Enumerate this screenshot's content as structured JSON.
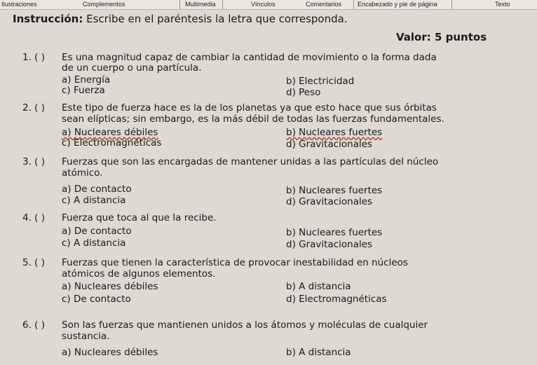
{
  "ribbon": {
    "tabs": [
      "Ilustraciones",
      "Complementos",
      "Multimedia",
      "Vínculos",
      "Comentarios",
      "Encabezado y pie de página",
      "Texto"
    ]
  },
  "worksheet": {
    "instruction_label": "Instrucción:",
    "instruction_text": " Escribe en el paréntesis la letra que corresponda.",
    "valor": "Valor: 5 puntos",
    "questions": [
      {
        "num": "1. (   )",
        "lines": [
          "Es una magnitud capaz de cambiar la cantidad de movimiento o la forma dada",
          "de un cuerpo o una partícula."
        ],
        "a": "a) Energía",
        "b": "b) Electricidad",
        "c": "c) Fuerza",
        "d": "d) Peso"
      },
      {
        "num": "2. (   )",
        "lines": [
          "Este tipo de fuerza hace es la de los planetas ya que esto hace que sus órbitas",
          "sean elípticas; sin embargo, es la más débil de todas las fuerzas fundamentales."
        ],
        "a": "a) Nucleares débiles",
        "b": "b) Nucleares fuertes",
        "c": "c) Electromagnéticas",
        "d": "d) Gravitacionales"
      },
      {
        "num": "3. (   )",
        "lines": [
          "Fuerzas que son las encargadas de mantener unidas a las partículas del núcleo",
          "atómico."
        ],
        "a": "a) De contacto",
        "b": "b) Nucleares fuertes",
        "c": "c) A distancia",
        "d": "d) Gravitacionales"
      },
      {
        "num": "4. (   )",
        "lines": [
          "Fuerza que toca al que la recibe."
        ],
        "a": "a) De contacto",
        "b": "b) Nucleares fuertes",
        "c": "c) A distancia",
        "d": "d) Gravitacionales"
      },
      {
        "num": "5. (   )",
        "lines": [
          "Fuerzas que tienen la característica de provocar inestabilidad en núcleos",
          "atómicos de algunos elementos."
        ],
        "a": "a) Nucleares débiles",
        "b": "b) A distancia",
        "c": "c) De contacto",
        "d": "d) Electromagnéticas"
      },
      {
        "num": "6. (   )",
        "lines": [
          "Son las fuerzas que mantienen unidos a los átomos y moléculas de cualquier",
          "sustancia."
        ],
        "a": "a) Nucleares débiles",
        "b": "b) A distancia"
      }
    ]
  }
}
